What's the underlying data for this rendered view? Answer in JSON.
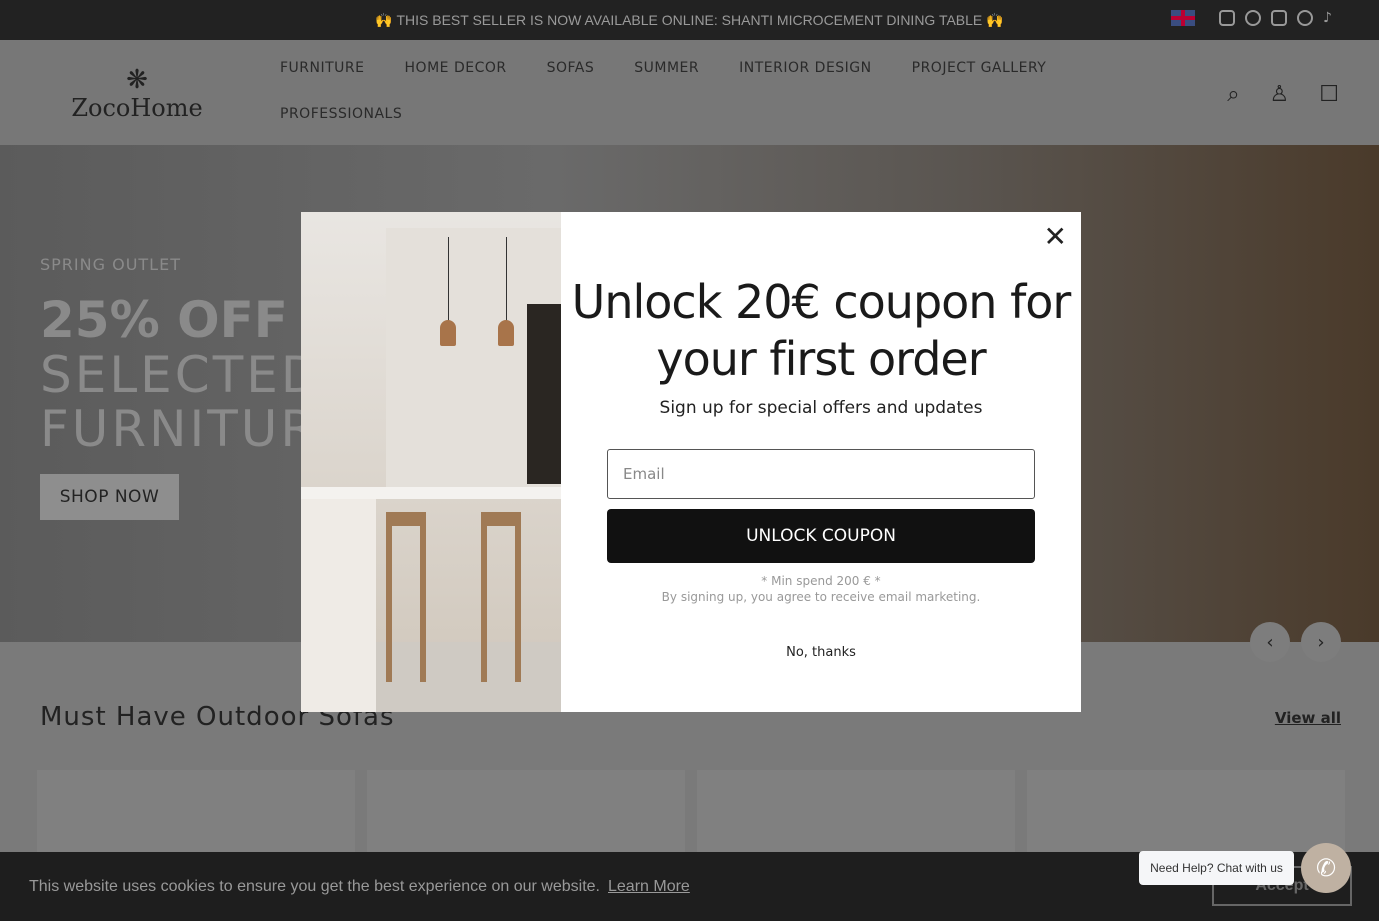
{
  "announcement": {
    "text": "🙌 THIS BEST SELLER IS NOW AVAILABLE ONLINE: SHANTI MICROCEMENT DINING TABLE 🙌",
    "icons": [
      "uk-flag-icon",
      "instagram-icon",
      "facebook-icon",
      "youtube-icon",
      "pinterest-icon",
      "tiktok-icon"
    ]
  },
  "header": {
    "logo": "ZocoHome",
    "nav": [
      "FURNITURE",
      "HOME DECOR",
      "SOFAS",
      "SUMMER",
      "INTERIOR DESIGN",
      "PROJECT GALLERY",
      "PROFESSIONALS"
    ],
    "icons": [
      "search-icon",
      "account-icon",
      "cart-icon"
    ]
  },
  "hero": {
    "kicker": "SPRING OUTLET",
    "headline": "25% OFF",
    "subheadline": "SELECTED FURNITURE",
    "cta": "SHOP NOW"
  },
  "section": {
    "title": "Must Have Outdoor Sofas",
    "view_all": "View all"
  },
  "modal": {
    "title": "Unlock 20€ coupon for your first order",
    "subtitle": "Sign up for special offers and updates",
    "email_placeholder": "Email",
    "button": "UNLOCK COUPON",
    "min_spend": "* Min spend 200 € *",
    "consent": "By signing up, you agree to receive email marketing.",
    "no_thanks": "No, thanks"
  },
  "cookie": {
    "text": "This website uses cookies to ensure you get the best experience on our website.",
    "learn_more": "Learn More",
    "accept": "Accept"
  },
  "chat": {
    "label": "Need Help? Chat with us"
  }
}
